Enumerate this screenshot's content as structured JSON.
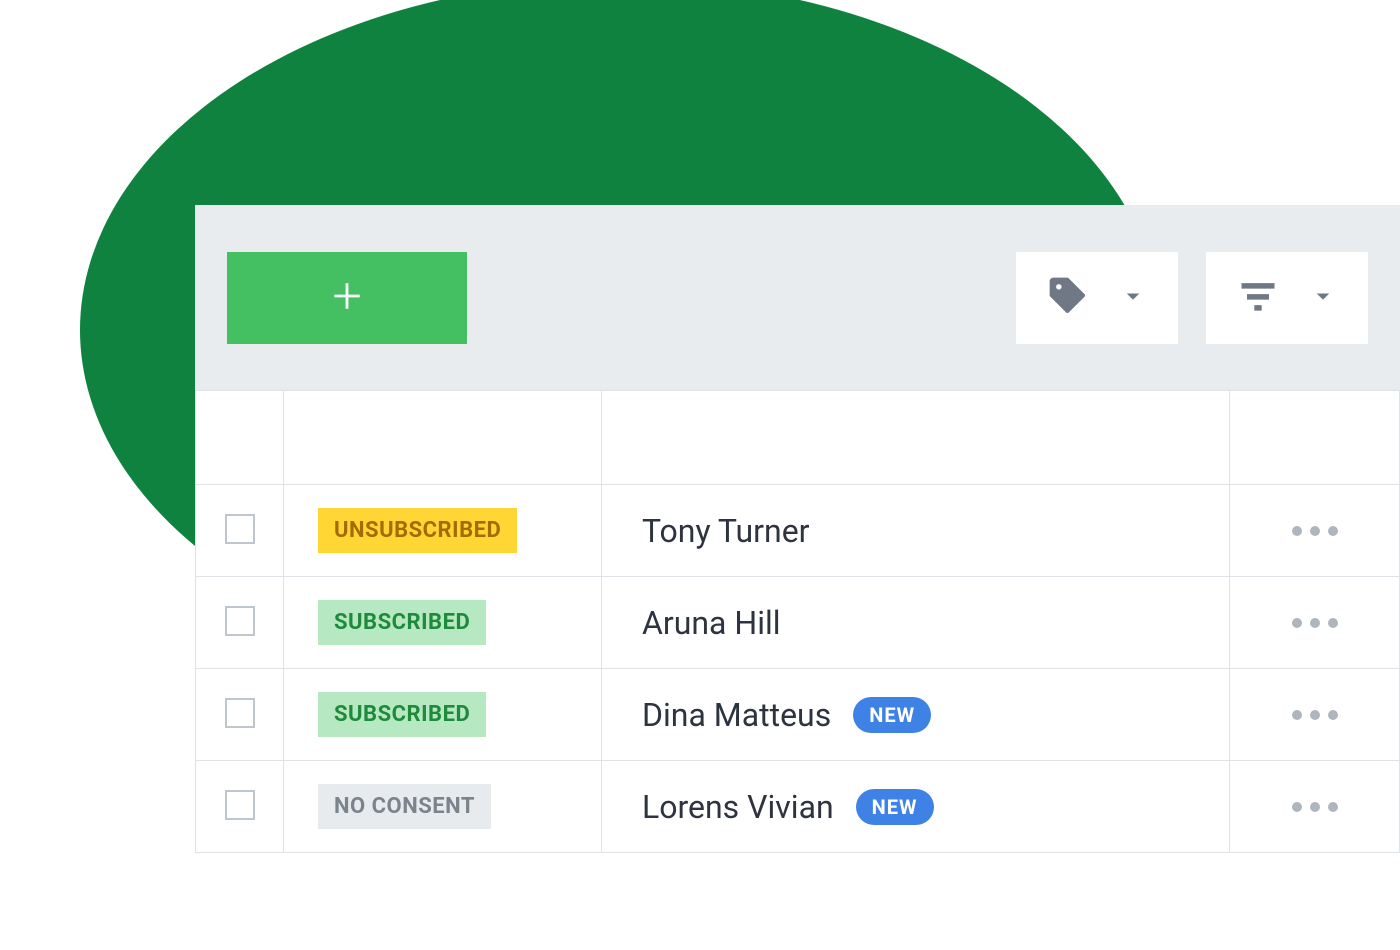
{
  "colors": {
    "blob": "#0f8240",
    "add_button": "#44bf61",
    "toolbar_bg": "#e9ecee",
    "border": "#dfe3e7",
    "icon_gray": "#6f7884",
    "new_badge": "#3e82e6"
  },
  "toolbar": {
    "add_icon": "plus-icon",
    "dropdowns": [
      {
        "icon": "tag-icon"
      },
      {
        "icon": "filter-icon"
      }
    ]
  },
  "status_styles": {
    "UNSUBSCRIBED": "status-unsubscribed",
    "SUBSCRIBED": "status-subscribed",
    "NO CONSENT": "status-noconsent"
  },
  "new_badge_label": "NEW",
  "rows": [
    {
      "status": "UNSUBSCRIBED",
      "name": "Tony Turner",
      "is_new": false
    },
    {
      "status": "SUBSCRIBED",
      "name": "Aruna Hill",
      "is_new": false
    },
    {
      "status": "SUBSCRIBED",
      "name": "Dina Matteus",
      "is_new": true
    },
    {
      "status": "NO CONSENT",
      "name": "Lorens Vivian",
      "is_new": true
    }
  ]
}
